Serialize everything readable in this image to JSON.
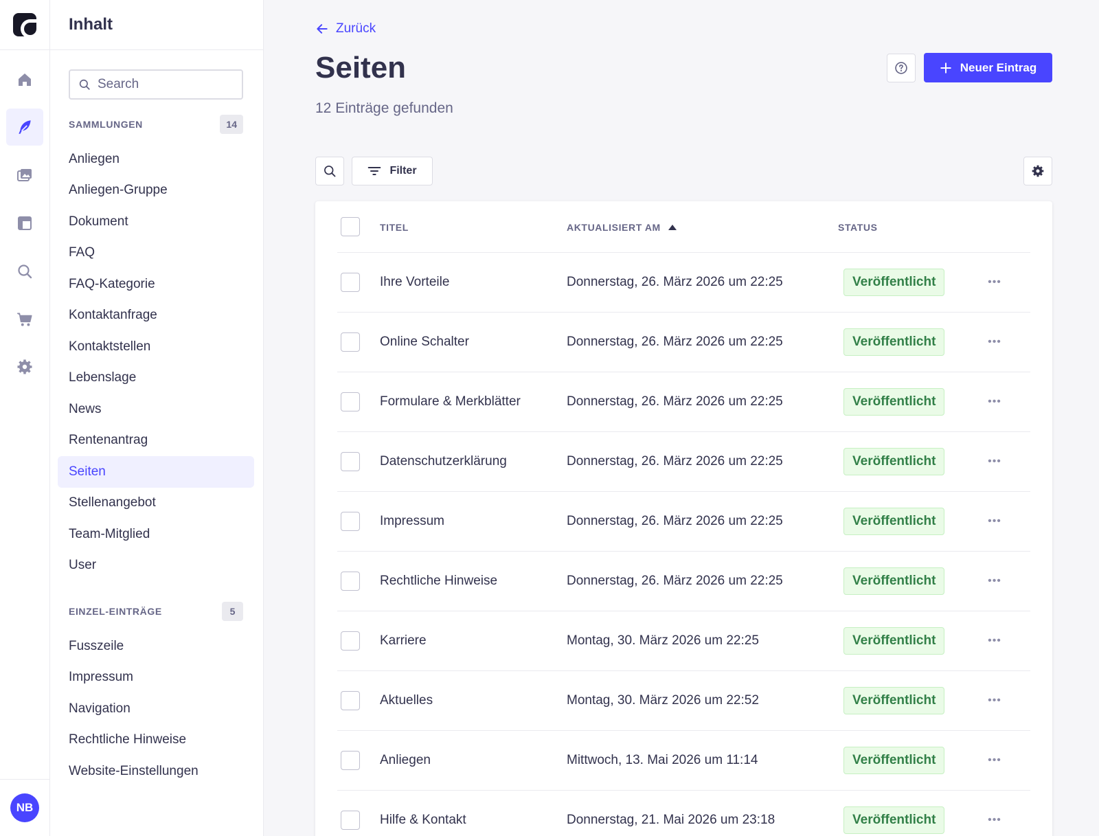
{
  "rail": {
    "items": [
      "home-icon",
      "content-icon",
      "media-icon",
      "layout-icon",
      "search-icon",
      "cart-icon",
      "settings-icon"
    ],
    "avatar": "NB"
  },
  "subnav": {
    "title": "Inhalt",
    "search_placeholder": "Search",
    "collections_title": "SAMMLUNGEN",
    "collections_count": "14",
    "collections": [
      "Anliegen",
      "Anliegen-Gruppe",
      "Dokument",
      "FAQ",
      "FAQ-Kategorie",
      "Kontaktanfrage",
      "Kontaktstellen",
      "Lebenslage",
      "News",
      "Rentenantrag",
      "Seiten",
      "Stellenangebot",
      "Team-Mitglied",
      "User"
    ],
    "single_title": "EINZEL-EINTRÄGE",
    "single_count": "5",
    "single": [
      "Fusszeile",
      "Impressum",
      "Navigation",
      "Rechtliche Hinweise",
      "Website-Einstellungen"
    ]
  },
  "main": {
    "back": "Zurück",
    "title": "Seiten",
    "subtitle": "12 Einträge gefunden",
    "new_entry": "Neuer Eintrag",
    "filter": "Filter"
  },
  "table": {
    "columns": {
      "title": "TITEL",
      "updated": "AKTUALISIERT AM",
      "status": "STATUS"
    },
    "rows": [
      {
        "title": "Ihre Vorteile",
        "updated": "Donnerstag, 26. März 2026 um 22:25",
        "status": "Veröffentlicht"
      },
      {
        "title": "Online Schalter",
        "updated": "Donnerstag, 26. März 2026 um 22:25",
        "status": "Veröffentlicht"
      },
      {
        "title": "Formulare & Merkblätter",
        "updated": "Donnerstag, 26. März 2026 um 22:25",
        "status": "Veröffentlicht"
      },
      {
        "title": "Datenschutzerklärung",
        "updated": "Donnerstag, 26. März 2026 um 22:25",
        "status": "Veröffentlicht"
      },
      {
        "title": "Impressum",
        "updated": "Donnerstag, 26. März 2026 um 22:25",
        "status": "Veröffentlicht"
      },
      {
        "title": "Rechtliche Hinweise",
        "updated": "Donnerstag, 26. März 2026 um 22:25",
        "status": "Veröffentlicht"
      },
      {
        "title": "Karriere",
        "updated": "Montag, 30. März 2026 um 22:25",
        "status": "Veröffentlicht"
      },
      {
        "title": "Aktuelles",
        "updated": "Montag, 30. März 2026 um 22:52",
        "status": "Veröffentlicht"
      },
      {
        "title": "Anliegen",
        "updated": "Mittwoch, 13. Mai 2026 um 11:14",
        "status": "Veröffentlicht"
      },
      {
        "title": "Hilfe & Kontakt",
        "updated": "Donnerstag, 21. Mai 2026 um 23:18",
        "status": "Veröffentlicht"
      }
    ]
  },
  "colors": {
    "accent": "#4945ff",
    "success_text": "#328048",
    "success_bg": "#eafbe7"
  }
}
